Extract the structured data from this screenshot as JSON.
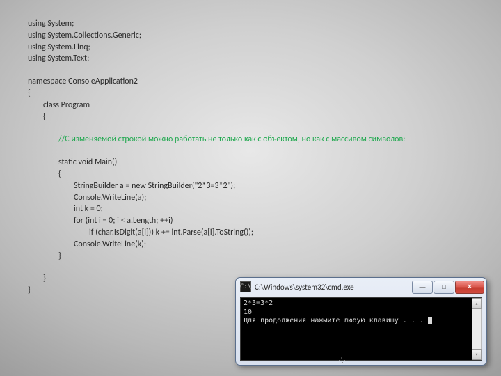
{
  "code": {
    "u1": "using System;",
    "u2": "using System.Collections.Generic;",
    "u3": "using System.Linq;",
    "u4": "using System.Text;",
    "ns": "namespace ConsoleApplication2",
    "ob": "{",
    "cls": "class Program",
    "ob2": "{",
    "comment": "//С изменяемой строкой можно работать не только как с объектом, но как с массивом символов:",
    "m1": "static void Main()",
    "m2": "{",
    "m3": "StringBuilder a = new StringBuilder(\"2*3=3*2\");",
    "m4": "Console.WriteLine(a);",
    "m5": "int k = 0;",
    "m6": "for (int i = 0; i < a.Length; ++i)",
    "m7": "if (char.IsDigit(a[i])) k += int.Parse(a[i].ToString());",
    "m8": "Console.WriteLine(k);",
    "m9": "}",
    "cb2": "}",
    "cb": "}"
  },
  "console": {
    "title": "C:\\Windows\\system32\\cmd.exe",
    "icon_glyph": "C:\\",
    "line1": "2*3=3*2",
    "line2": "10",
    "line3": "Для продолжения нажмите любую клавишу . . . ",
    "btn_min": "—",
    "btn_max": "□",
    "btn_close": "×",
    "scroll_up": "▴",
    "scroll_down": "▾",
    "resize_grip": "⋰⋰"
  }
}
